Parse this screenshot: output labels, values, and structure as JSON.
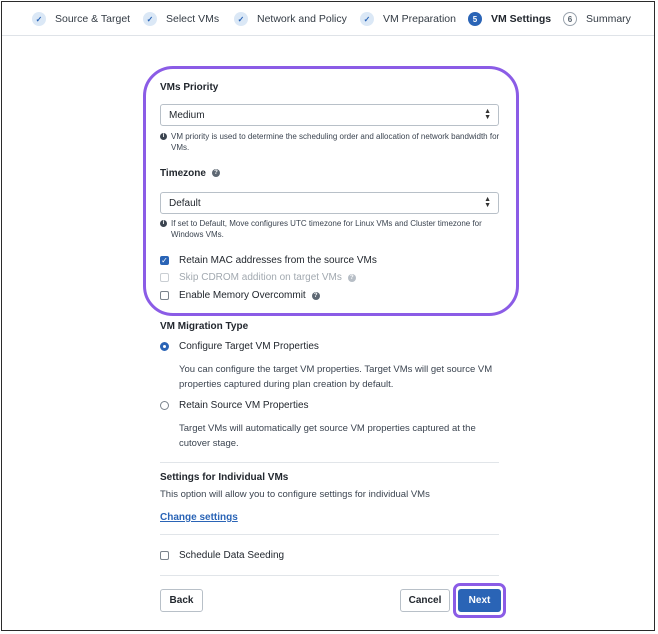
{
  "stepper": {
    "steps": [
      {
        "label": "Source & Target",
        "state": "done",
        "marker": "✓"
      },
      {
        "label": "Select VMs",
        "state": "done",
        "marker": "✓"
      },
      {
        "label": "Network and Policy",
        "state": "done",
        "marker": "✓"
      },
      {
        "label": "VM Preparation",
        "state": "done",
        "marker": "✓"
      },
      {
        "label": "VM Settings",
        "state": "active",
        "marker": "5"
      },
      {
        "label": "Summary",
        "state": "pending",
        "marker": "6"
      }
    ]
  },
  "vms_priority": {
    "label": "VMs Priority",
    "selected": "Medium",
    "info": "VM priority is used to determine the scheduling order and allocation of network bandwidth for VMs."
  },
  "timezone": {
    "label": "Timezone",
    "selected": "Default",
    "info": "If set to Default, Move configures UTC timezone for Linux VMs and Cluster timezone for Windows VMs."
  },
  "checkboxes": {
    "retain_mac": {
      "label": "Retain MAC addresses from the source VMs",
      "checked": true,
      "disabled": false
    },
    "skip_cdrom": {
      "label": "Skip CDROM addition on target VMs",
      "checked": false,
      "disabled": true
    },
    "memory_overcommit": {
      "label": "Enable Memory Overcommit",
      "checked": false,
      "disabled": false
    }
  },
  "migration_type": {
    "label": "VM Migration Type",
    "options": [
      {
        "label": "Configure Target VM Properties",
        "checked": true,
        "description": "You can configure the target VM properties. Target VMs will get source VM properties captured during plan creation by default."
      },
      {
        "label": "Retain Source VM Properties",
        "checked": false,
        "description": "Target VMs will automatically get source VM properties captured at the cutover stage."
      }
    ]
  },
  "individual_settings": {
    "title": "Settings for Individual VMs",
    "description": "This option will allow you to configure settings for individual VMs",
    "link": "Change settings"
  },
  "data_seeding": {
    "label": "Schedule Data Seeding",
    "checked": false
  },
  "footer": {
    "back": "Back",
    "cancel": "Cancel",
    "next": "Next"
  },
  "colors": {
    "accent": "#2a64b6",
    "highlight": "#8b5ce6"
  },
  "icons": {
    "check": "check-icon",
    "info": "info-icon",
    "help": "help-icon",
    "caret": "select-caret-icon"
  }
}
